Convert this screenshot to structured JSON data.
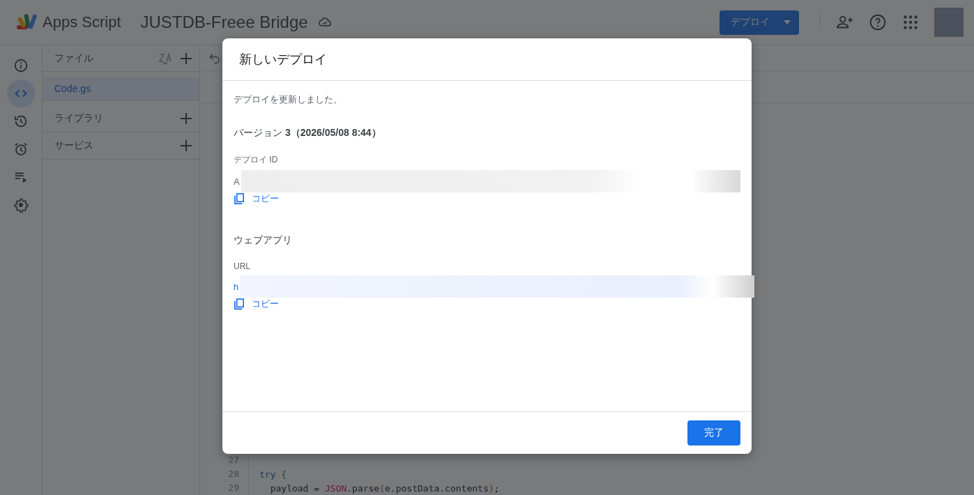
{
  "app": {
    "name": "Apps Script",
    "project_title": "JUSTDB-Freee Bridge"
  },
  "header": {
    "deploy_button": "デプロイ"
  },
  "rail": [
    {
      "kind": "info",
      "selected": false
    },
    {
      "kind": "code",
      "selected": true
    },
    {
      "kind": "history",
      "selected": false
    },
    {
      "kind": "triggers",
      "selected": false
    },
    {
      "kind": "executions",
      "selected": false
    },
    {
      "kind": "settings",
      "selected": false
    }
  ],
  "files_panel": {
    "title": "ファイル",
    "files": [
      {
        "name": "Code.gs",
        "selected": true
      }
    ],
    "sections": [
      {
        "label": "ライブラリ"
      },
      {
        "label": "サービス"
      }
    ]
  },
  "editor": {
    "lines": [
      {
        "number": "27"
      },
      {
        "number": "28",
        "tokens": [
          {
            "kind": "keyword",
            "text": "try"
          },
          {
            "kind": "brace",
            "text": " {"
          }
        ]
      },
      {
        "number": "29",
        "tokens": [
          {
            "kind": "plain",
            "text": "  payload = "
          },
          {
            "kind": "global",
            "text": "JSON"
          },
          {
            "kind": "plain",
            "text": ".parse"
          },
          {
            "kind": "paren",
            "text": "("
          },
          {
            "kind": "plain",
            "text": "e.postData.contents"
          },
          {
            "kind": "paren",
            "text": ")"
          },
          {
            "kind": "plain",
            "text": ";"
          }
        ]
      }
    ]
  },
  "dialog": {
    "title": "新しいデプロイ",
    "message": "デプロイを更新しました。",
    "version": "バージョン **3（2026/05/08 8:44）**",
    "deployment_id": {
      "label": "デプロイ ID",
      "value": "A",
      "copy": "コピー"
    },
    "web_app": {
      "title": "ウェブアプリ",
      "label": "URL",
      "value": "h",
      "copy": "コピー"
    },
    "done_button": "完了"
  }
}
